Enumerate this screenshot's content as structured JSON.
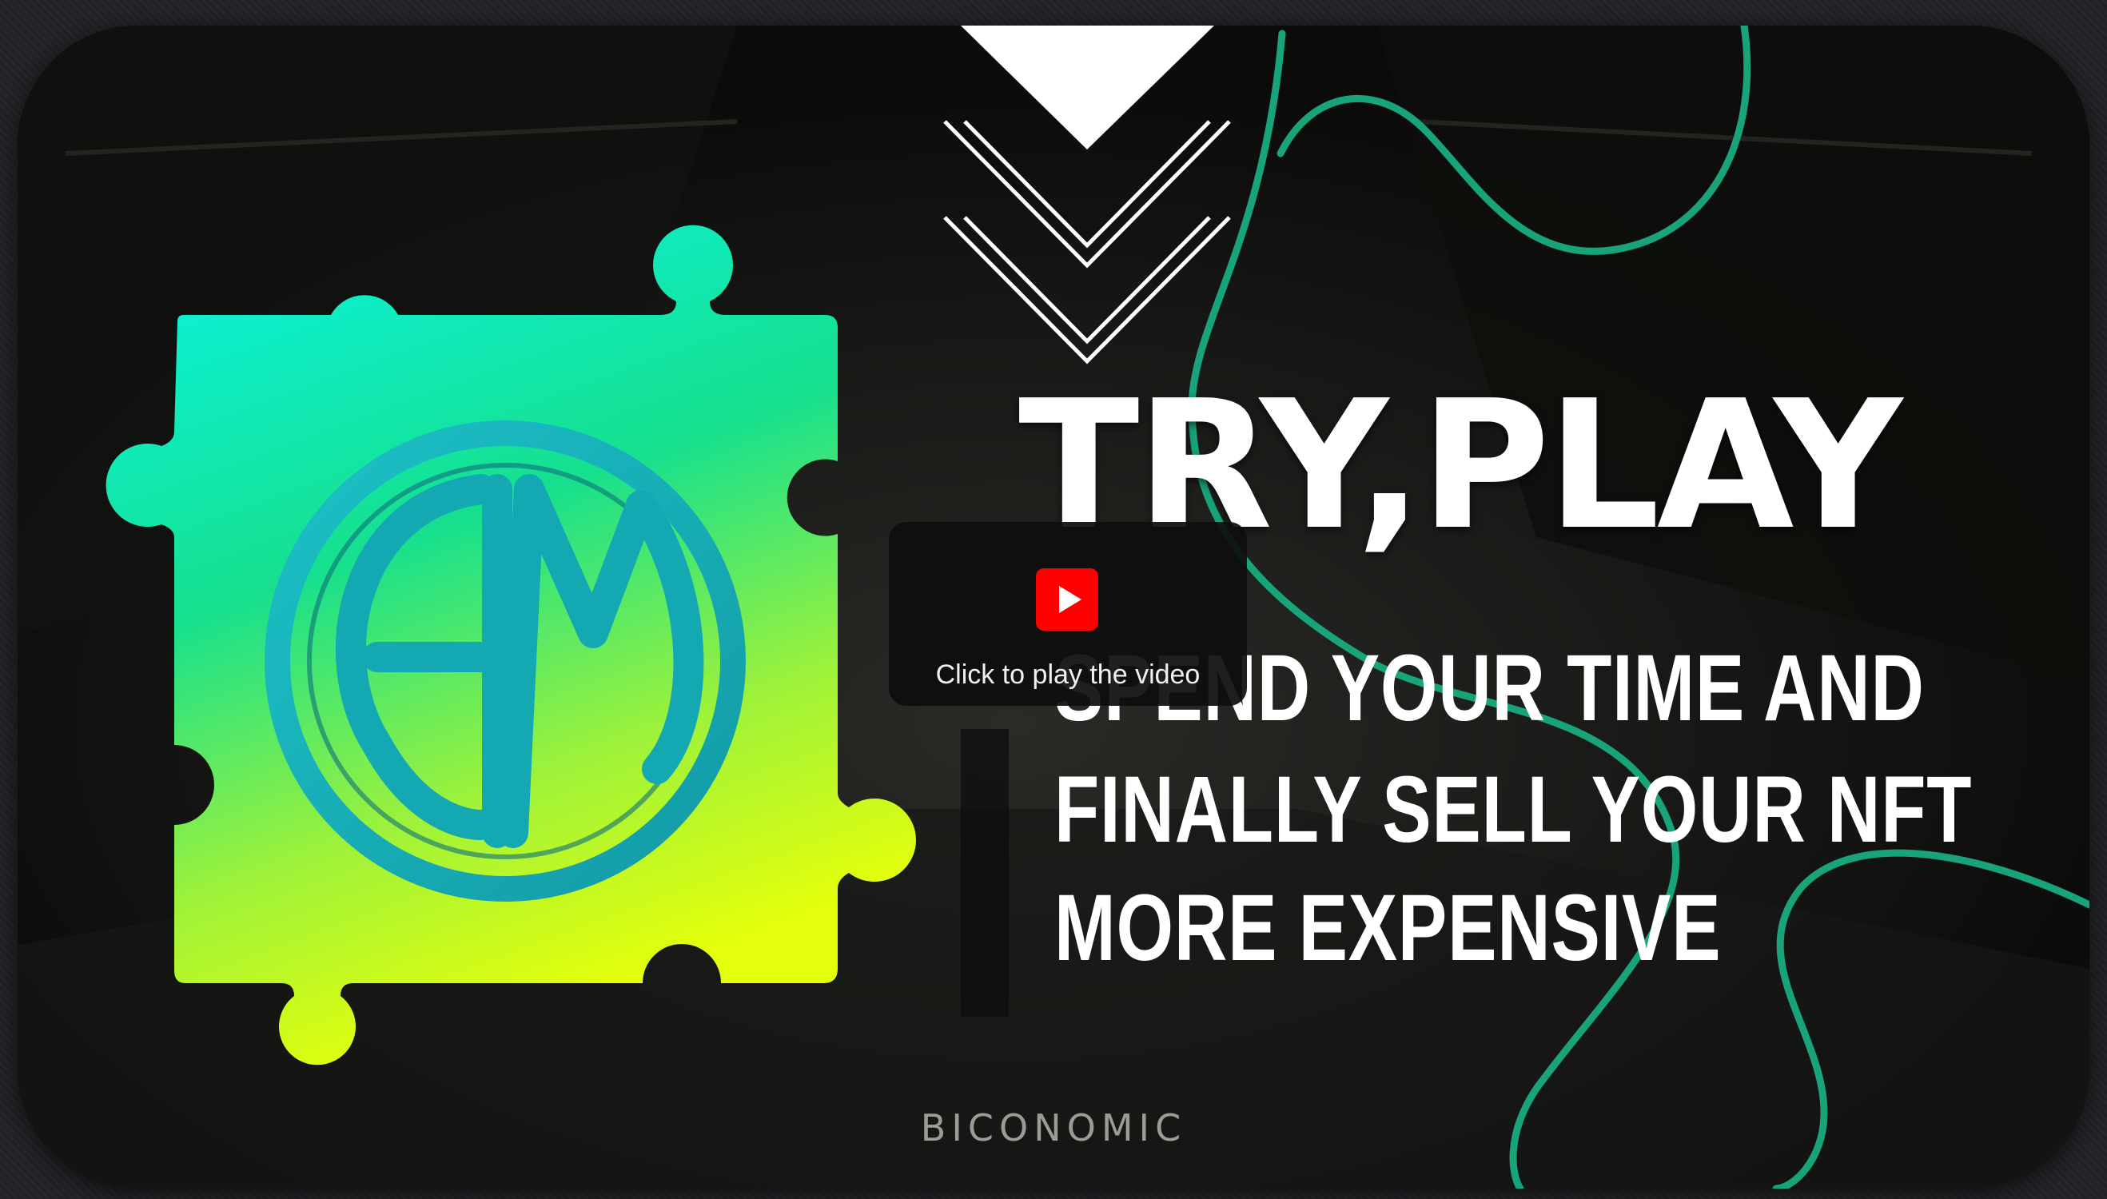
{
  "video": {
    "headline": "TRY,PLAY",
    "subline": [
      "SPEND YOUR TIME AND",
      "FINALLY SELL YOUR NFT",
      "MORE EXPENSIVE"
    ],
    "brand": "BICONOMIC",
    "logo_letters": "BM"
  },
  "player": {
    "play_caption": "Click to play the video",
    "icon": "youtube-play-icon"
  },
  "colors": {
    "accent_green": "#18a37a",
    "youtube_red": "#ff0000",
    "puzzle_top": "#d8fbf2",
    "puzzle_mid": "#10e8c8",
    "puzzle_bottom": "#d8ff10",
    "ring": "#1aa9b0"
  }
}
